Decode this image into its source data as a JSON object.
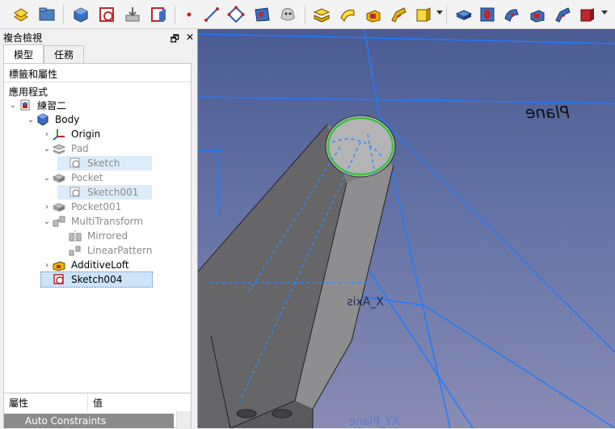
{
  "toolbar": {
    "icons": [
      "part-design-workbench-icon",
      "open-icon",
      "create-body-icon",
      "create-sketch-icon",
      "validate-sketch-icon",
      "close-sketch-icon",
      "datum-plane-icon",
      "datum-point-icon",
      "datum-line-icon",
      "datum-plane2-icon",
      "local-coordinate-icon",
      "shape-binder-icon",
      "clone-icon",
      "pad-icon",
      "revolution-icon",
      "additive-loft-icon",
      "additive-pipe-icon",
      "additive-primitive-icon",
      "pocket-icon",
      "hole-icon",
      "groove-icon",
      "subtractive-loft-icon",
      "subtractive-pipe-icon",
      "subtractive-primitive-icon"
    ]
  },
  "panel": {
    "title": "複合檢視",
    "float_btn": "🗗",
    "close_btn": "✕",
    "tabs": [
      {
        "label": "模型"
      },
      {
        "label": "任務"
      }
    ],
    "tree_header": "標籤和屬性",
    "tree_section": "應用程式",
    "tree": [
      {
        "label": "練習二",
        "exp": "⌄"
      },
      {
        "label": "Body",
        "exp": "⌄"
      },
      {
        "label": "Origin",
        "exp": "›"
      },
      {
        "label": "Pad",
        "exp": "⌄"
      },
      {
        "label": "Sketch",
        "exp": ""
      },
      {
        "label": "Pocket",
        "exp": "⌄"
      },
      {
        "label": "Sketch001",
        "exp": ""
      },
      {
        "label": "Pocket001",
        "exp": "›"
      },
      {
        "label": "MultiTransform",
        "exp": "⌄"
      },
      {
        "label": "Mirrored",
        "exp": ""
      },
      {
        "label": "LinearPattern",
        "exp": ""
      },
      {
        "label": "AdditiveLoft",
        "exp": "›"
      },
      {
        "label": "Sketch004",
        "exp": ""
      }
    ]
  },
  "props": {
    "col_property": "屬性",
    "col_value": "值",
    "row_label": "Auto Constraints"
  },
  "viewport": {
    "labels": {
      "axis_x": "X_Axis",
      "plane_label": "XY_Plane",
      "top_text": "Plane"
    }
  },
  "colors": {
    "viewport_top": "#4a5c93",
    "viewport_bottom": "#8a8cb4",
    "edge_green": "#3cc13c",
    "datum_blue": "#1e7bff",
    "selected_bg": "#cde3f9"
  }
}
